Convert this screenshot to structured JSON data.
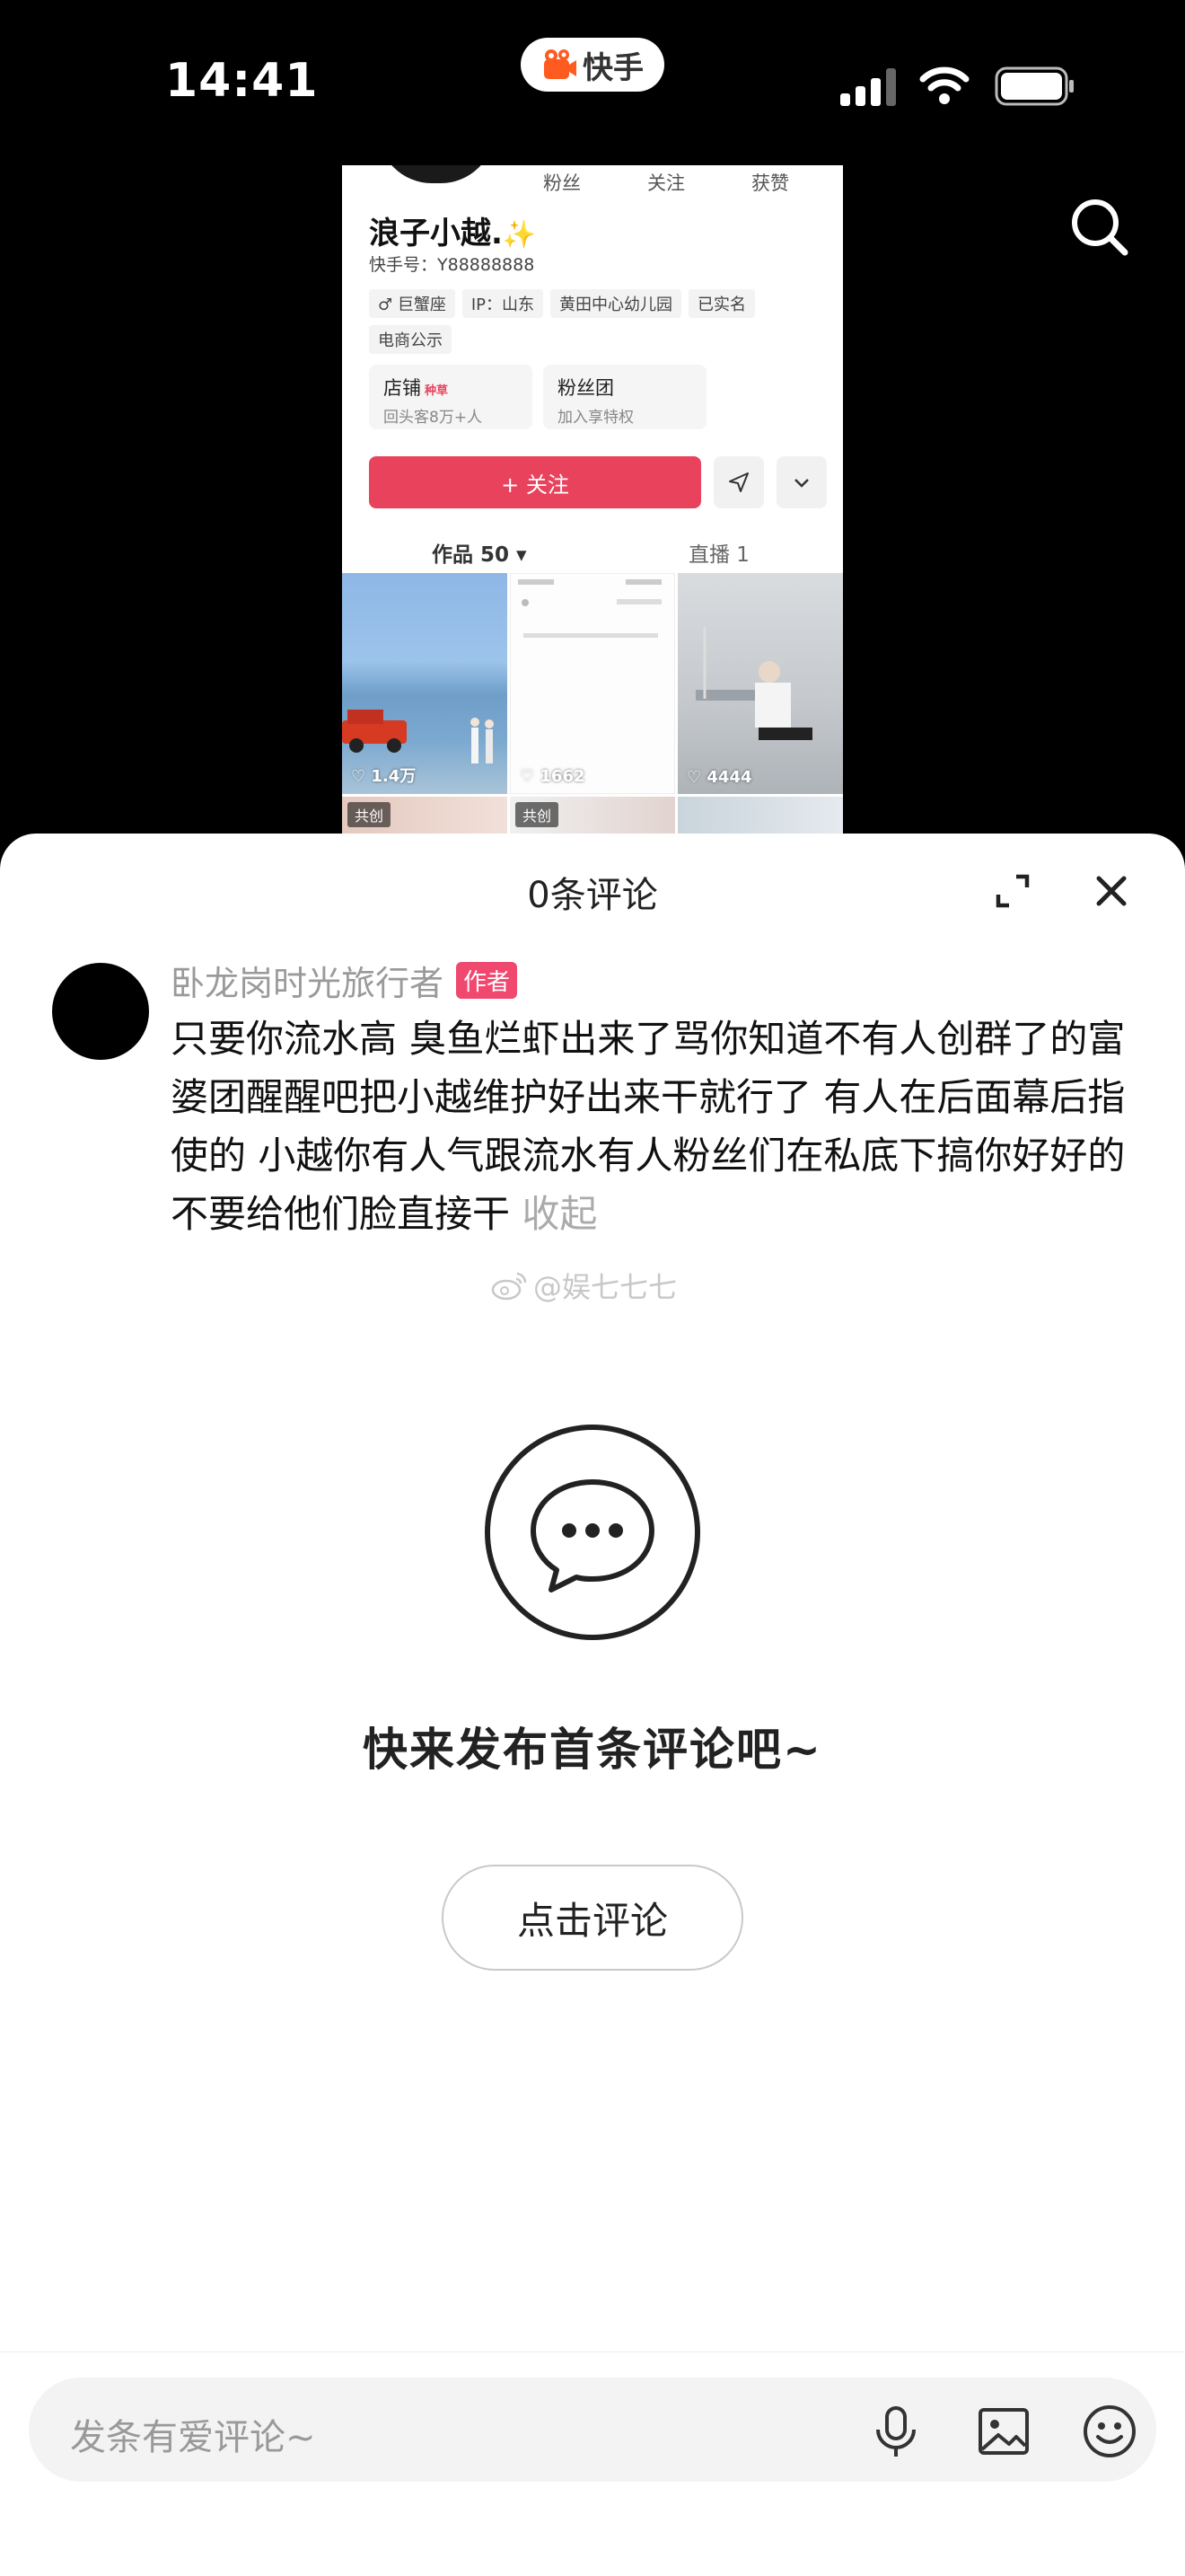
{
  "status_bar": {
    "time": "14:41",
    "app_name": "快手"
  },
  "profile": {
    "stats": [
      "粉丝",
      "关注",
      "获赞"
    ],
    "name": "浪子小越.",
    "kuaishou_id": "快手号：Y88888888",
    "tags": [
      "♂ 巨蟹座",
      "IP：山东",
      "黄田中心幼儿园",
      "已实名",
      "电商公示"
    ],
    "cards": [
      {
        "title": "店铺",
        "hot": "种草",
        "sub": "回头客8万+人"
      },
      {
        "title": "粉丝团",
        "hot": "",
        "sub": "加入享特权"
      }
    ],
    "follow_label": "+ 关注",
    "tabs": [
      "作品 50 ▾",
      "直播 1"
    ],
    "grid": [
      {
        "likes": "♡ 1.4万"
      },
      {
        "likes": "♡ 1662"
      },
      {
        "likes": "♡ 4444"
      }
    ],
    "grid_row2_badges": [
      "共创",
      "共创"
    ]
  },
  "comments": {
    "title": "0条评论",
    "author": "卧龙岗时光旅行者",
    "author_badge": "作者",
    "text": "只要你流水高 臭鱼烂虾出来了骂你知道不有人创群了的富婆团醒醒吧把小越维护好出来干就行了 有人在后面幕后指使的 小越你有人气跟流水有人粉丝们在私底下搞你好好的不要给他们脸直接干",
    "fold_label": "收起",
    "watermark": "@娱七七七",
    "empty_text": "快来发布首条评论吧~",
    "comment_button": "点击评论",
    "input_placeholder": "发条有爱评论~"
  },
  "colors": {
    "accent": "#e8425c",
    "badge": "#f0486e"
  }
}
